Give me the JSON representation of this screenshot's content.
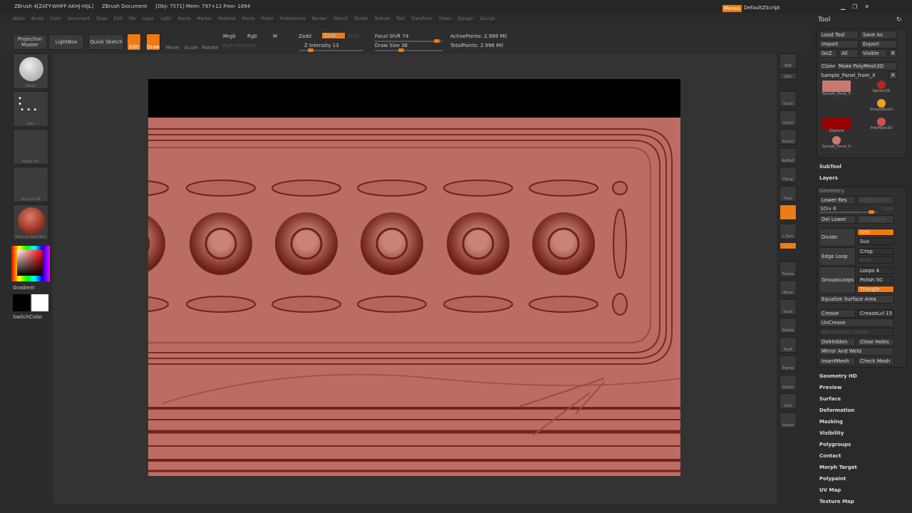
{
  "title": {
    "app": "ZBrush 4[ZATY-WHFF-AKHJ-HIJL]",
    "doc": "ZBrush Document",
    "stats": "[Obj› 7571] Mem› 797+12 Free› 1894"
  },
  "menus": [
    "Alpha",
    "Brush",
    "Color",
    "Document",
    "Draw",
    "Edit",
    "File",
    "Layer",
    "Light",
    "Macro",
    "Marker",
    "Material",
    "Movie",
    "Picker",
    "Preferences",
    "Render",
    "Stencil",
    "Stroke",
    "Texture",
    "Tool",
    "Transform",
    "Zoom",
    "Zplugin",
    "Zscript"
  ],
  "topright": {
    "menus": "Menus",
    "script": "DefaultZScript"
  },
  "toolbar": {
    "projection_master": "Projection Master",
    "lightbox": "LightBox",
    "quick_sketch": "Quick Sketch",
    "edit": "Edit",
    "draw": "Draw",
    "move": "Move",
    "scale": "Scale",
    "rotate": "Rotate",
    "mrgb": "Mrgb",
    "rgb": "Rgb",
    "m": "M",
    "rgb_intensity": "Rgb Intensity",
    "zadd": "Zadd",
    "zsub": "Zsub",
    "zcut": "Zcut",
    "z_intensity": "Z Intensity 13",
    "focal_shift": "Focal Shift 74",
    "draw_size": "Draw Size 38",
    "active_points": "ActivePoints: 2.998 Mil",
    "total_points": "TotalPoints: 2.998 Mil"
  },
  "sliders": {
    "z_intensity": 13,
    "focal_shift": 74,
    "draw_size": 38
  },
  "left_shelf": {
    "brush": "Std3D",
    "stroke": "Dots",
    "alpha": "Alpha Off",
    "texture": "Texture Off",
    "material": "MatCap Red Wax",
    "gradient": "Gradient",
    "switch_color": "SwitchColor"
  },
  "right_shelf": [
    "BPR",
    "SPix",
    "Scroll",
    "Zoom",
    "Actual",
    "AAHalf",
    "Persp",
    "Floor",
    "Local",
    "L.Sym",
    "xyz",
    "Frame",
    "Move",
    "Scale",
    "Rotate",
    "PolyF",
    "Transp",
    "Ghost",
    "Solo",
    "Xpose"
  ],
  "panel": {
    "title": "Tool",
    "load_tool": "Load Tool",
    "save_as": "Save As",
    "import": "Import",
    "export": "Export",
    "goz": "GoZ",
    "all": "All",
    "visible": "Visible",
    "r": "R",
    "clone": "Clone",
    "make_polymesh": "Make PolyMesh3D",
    "current_tool": "Sample_Panel_from_X",
    "tools": [
      "Sample_Panel_fr",
      "Sphere3D",
      "SimpleBrush",
      "ZSphere",
      "PolyMesh3D",
      "Sample_Panel_fr"
    ],
    "subtool": "SubTool",
    "layers": "Layers",
    "geometry": "Geometry",
    "lower_res": "Lower Res",
    "higher_res": "Higher Res",
    "sdiv": "SDiv 6",
    "cage": "Cage",
    "del_lower": "Del Lower",
    "del_higher": "Del Higher",
    "divide": "Divide",
    "smt": "Smt",
    "suv": "Suv",
    "edge_loop": "Edge Loop",
    "crisp": "Crisp",
    "disp": "Disp",
    "groups_loops": "GroupsLoops",
    "loops": "Loops 4",
    "polish": "Polish 50",
    "triangle": "Triangle",
    "equalize": "Equalize Surface Area",
    "crease": "Crease",
    "crease_lvl": "CreaseLvl 15",
    "uncrease": "UnCrease",
    "reconstruct": "Reconstruct Subdiv",
    "delhidden": "DelHidden",
    "close_holes": "Close Holes",
    "mirror_weld": "Mirror And Weld",
    "insertmesh": "InsertMesh",
    "check_mesh": "Check Mesh",
    "sections": [
      "Geometry HD",
      "Preview",
      "Surface",
      "Deformation",
      "Masking",
      "Visibility",
      "Polygroups",
      "Contact",
      "Morph Target",
      "Polypaint",
      "UV Map",
      "Texture Map"
    ]
  },
  "colors": {
    "accent": "#f07a10",
    "mesh": "#bb6d64",
    "bg": "#2b2b2b"
  }
}
